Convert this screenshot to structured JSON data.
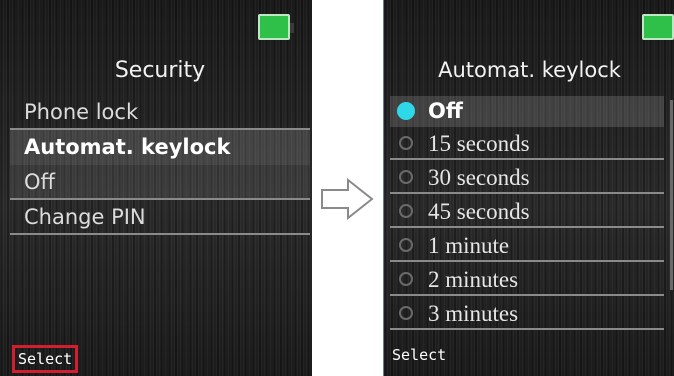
{
  "left_screen": {
    "title": "Security",
    "menu_items": [
      "Phone lock",
      "Automat. keylock",
      "Off",
      "Change PIN"
    ],
    "softkey": "Select"
  },
  "right_screen": {
    "title": "Automat. keylock",
    "options": [
      "Off",
      "15 seconds",
      "30 seconds",
      "45 seconds",
      "1 minute",
      "2 minutes",
      "3 minutes"
    ],
    "selected_index": 0,
    "softkey": "Select"
  },
  "colors": {
    "battery": "#2fc04a",
    "radio_selected": "#2fd8e8",
    "softkey_highlight": "#d21f2f"
  }
}
